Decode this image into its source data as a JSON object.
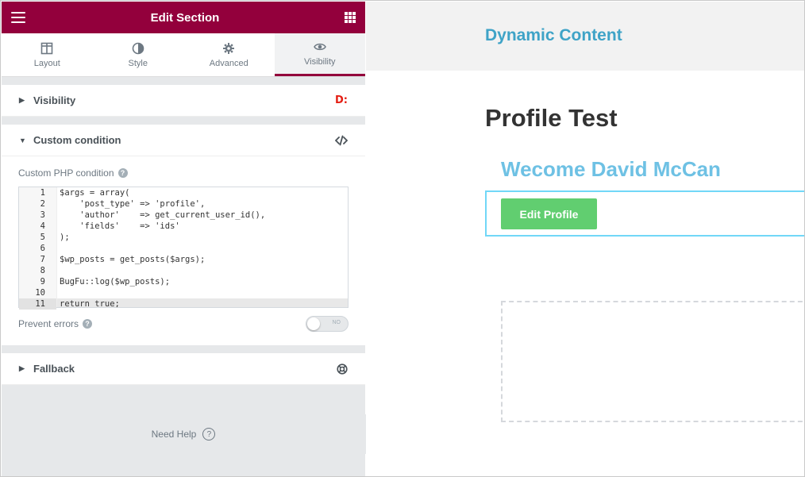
{
  "panel": {
    "title": "Edit Section",
    "tabs": [
      {
        "label": "Layout",
        "icon": "layout-icon"
      },
      {
        "label": "Style",
        "icon": "half-circle-icon"
      },
      {
        "label": "Advanced",
        "icon": "gear-icon"
      },
      {
        "label": "Visibility",
        "icon": "eye-icon"
      }
    ],
    "active_tab": "Visibility",
    "sections": {
      "visibility": {
        "label": "Visibility",
        "badge": "D:"
      },
      "custom": {
        "label": "Custom condition",
        "icon": "code-icon"
      },
      "fallback": {
        "label": "Fallback",
        "icon": "lifebuoy-icon"
      }
    },
    "custom_php_label": "Custom PHP condition",
    "code": {
      "line_numbers": [
        "1",
        "2",
        "3",
        "4",
        "5",
        "6",
        "7",
        "8",
        "9",
        "10",
        "11"
      ],
      "lines": [
        "$args = array(",
        "    'post_type' => 'profile',",
        "    'author'    => get_current_user_id(),",
        "    'fields'    => 'ids'",
        ");",
        "",
        "$wp_posts = get_posts($args);",
        "",
        "BugFu::log($wp_posts);",
        "",
        "return true;"
      ],
      "current_line": 11
    },
    "prevent_errors": {
      "label": "Prevent errors",
      "toggle_text": "NO"
    },
    "need_help": "Need Help",
    "help_glyph": "?"
  },
  "preview": {
    "site_title": "Dynamic Content",
    "page_title": "Profile Test",
    "welcome": "Wecome David McCan",
    "button": "Edit Profile"
  },
  "colors": {
    "brand": "#93003c",
    "site_title": "#3ea3c7",
    "welcome": "#6ec1e4",
    "button": "#61ce70",
    "selection": "#71d7f7"
  }
}
